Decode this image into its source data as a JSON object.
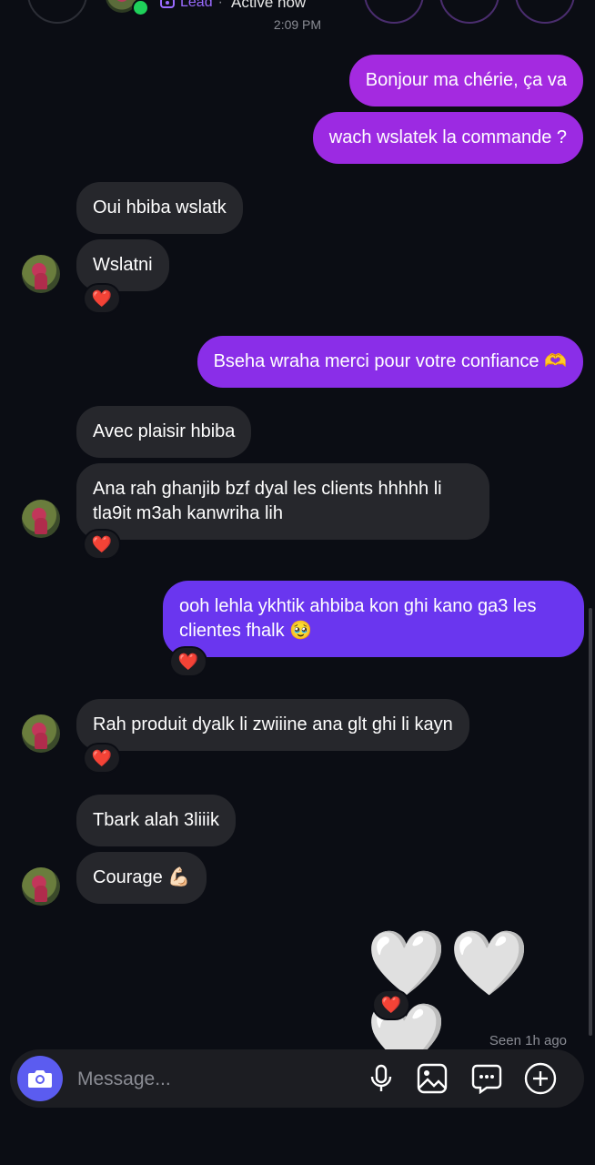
{
  "header": {
    "lead_label": "Lead",
    "separator": "·",
    "status": "Active now",
    "timestamp": "2:09 PM"
  },
  "messages": [
    {
      "dir": "out",
      "text": "Bonjour ma chérie, ça va"
    },
    {
      "dir": "out",
      "text": "wach wslatek la commande ?"
    },
    {
      "dir": "in",
      "text": "Oui hbiba wslatk"
    },
    {
      "dir": "in",
      "text": "Wslatni",
      "reaction": "❤️"
    },
    {
      "dir": "out",
      "text": "Bseha wraha merci pour votre confiance 🫶"
    },
    {
      "dir": "in",
      "text": "Avec plaisir hbiba"
    },
    {
      "dir": "in",
      "text_line1": "Ana rah ghanjib bzf dyal les clients hhhhh li",
      "text_line2": "tla9it m3ah kanwriha lih",
      "reaction": "❤️"
    },
    {
      "dir": "out",
      "text_line1": "ooh lehla ykhtik ahbiba kon ghi kano ga3 les",
      "text_line2": "clientes fhalk 🥹",
      "reaction": "❤️"
    },
    {
      "dir": "in",
      "text": "Rah produit dyalk li zwiiine ana glt ghi li kayn",
      "reaction": "❤️"
    },
    {
      "dir": "in",
      "text": "Tbark alah 3liiik"
    },
    {
      "dir": "in",
      "text": "Courage 💪🏻"
    },
    {
      "dir": "out",
      "text": "🤍🤍🤍",
      "reaction": "❤️"
    }
  ],
  "seen_status": "Seen 1h ago",
  "composer": {
    "placeholder": "Message..."
  },
  "icons": {
    "camera": "camera-icon",
    "mic": "microphone-icon",
    "gallery": "gallery-icon",
    "sticker": "sticker-icon",
    "add": "add-icon"
  },
  "colors": {
    "background": "#0b0d14",
    "incoming_bubble": "#26272c",
    "outgoing_gradient_top": "#a42ae0",
    "outgoing_gradient_bottom": "#6a36ef",
    "camera_button": "#5b5cf0",
    "online": "#1fd15a"
  }
}
